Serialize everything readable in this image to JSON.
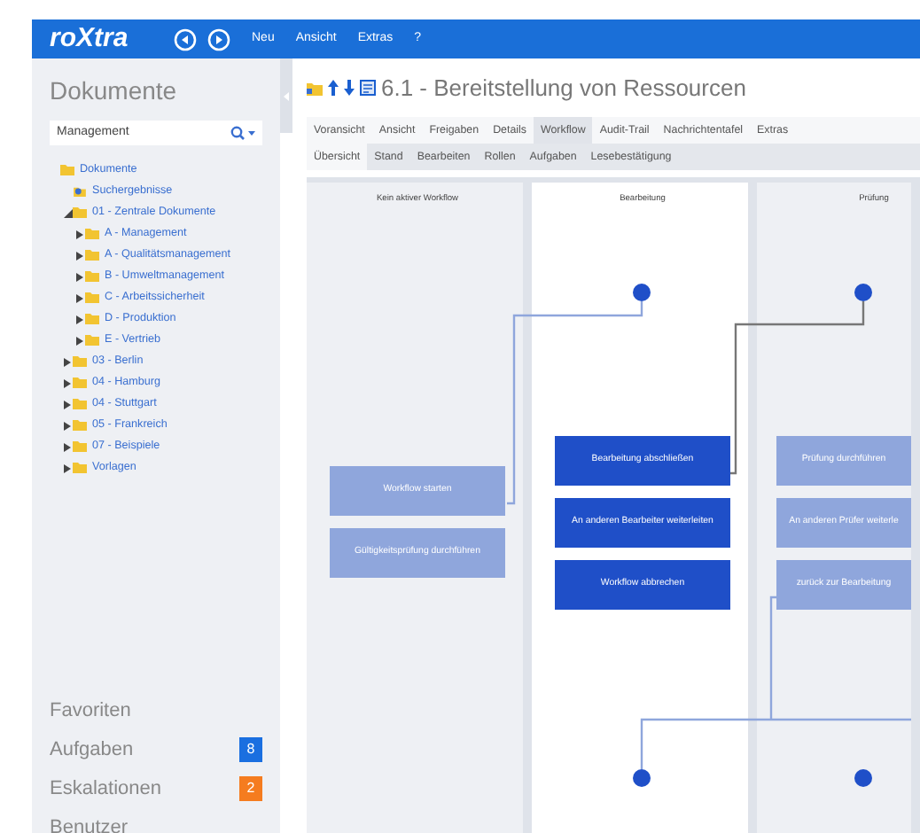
{
  "app": {
    "logo": "roXtra",
    "menu": [
      "Neu",
      "Ansicht",
      "Extras",
      "?"
    ]
  },
  "sidebar": {
    "title": "Dokumente",
    "search": {
      "value": "Management"
    },
    "tree": [
      {
        "label": "Dokumente",
        "kind": "folder",
        "children": [
          {
            "label": "Suchergebnisse",
            "kind": "search"
          },
          {
            "label": "01 - Zentrale Dokumente",
            "kind": "folder",
            "expanded": true,
            "children": [
              {
                "label": "A - Management",
                "kind": "folder",
                "expanded": false
              },
              {
                "label": "A - Qualitätsmanagement",
                "kind": "folder",
                "expanded": false
              },
              {
                "label": "B - Umweltmanagement",
                "kind": "folder",
                "expanded": false
              },
              {
                "label": "C - Arbeitssicherheit",
                "kind": "folder",
                "expanded": false
              },
              {
                "label": "D - Produktion",
                "kind": "folder",
                "expanded": false
              },
              {
                "label": "E - Vertrieb",
                "kind": "folder",
                "expanded": false
              }
            ]
          },
          {
            "label": "03 - Berlin",
            "kind": "folder",
            "expanded": false
          },
          {
            "label": "04 - Hamburg",
            "kind": "folder",
            "expanded": false
          },
          {
            "label": "04 - Stuttgart",
            "kind": "folder",
            "expanded": false
          },
          {
            "label": "05 - Frankreich",
            "kind": "folder",
            "expanded": false
          },
          {
            "label": "07 - Beispiele",
            "kind": "folder",
            "expanded": false
          },
          {
            "label": "Vorlagen",
            "kind": "folder",
            "expanded": false
          }
        ]
      }
    ],
    "links": [
      {
        "label": "Favoriten"
      },
      {
        "label": "Aufgaben",
        "badge": "8",
        "color": "#1a6fe0"
      },
      {
        "label": "Eskalationen",
        "badge": "2",
        "color": "#f57c1f"
      },
      {
        "label": "Benutzer"
      }
    ]
  },
  "document": {
    "title": "6.1 - Bereitstellung von Ressourcen",
    "tabs": [
      {
        "label": "Voransicht",
        "selected": false
      },
      {
        "label": "Ansicht",
        "selected": false
      },
      {
        "label": "Freigaben",
        "selected": false
      },
      {
        "label": "Details",
        "selected": false
      },
      {
        "label": "Workflow",
        "selected": true
      },
      {
        "label": "Audit-Trail",
        "selected": false
      },
      {
        "label": "Nachrichtentafel",
        "selected": false
      },
      {
        "label": "Extras",
        "selected": false
      }
    ],
    "subtabs": [
      {
        "label": "Übersicht",
        "selected": true
      },
      {
        "label": "Stand",
        "selected": false
      },
      {
        "label": "Bearbeiten",
        "selected": false
      },
      {
        "label": "Rollen",
        "selected": false
      },
      {
        "label": "Aufgaben",
        "selected": false
      },
      {
        "label": "Lesebestätigung",
        "selected": false
      }
    ]
  },
  "workflow": {
    "columns": [
      {
        "title": "Kein aktiver Workflow",
        "current": false,
        "actions": [
          {
            "label": "Workflow starten",
            "kind": "secondary"
          },
          {
            "label": "Gültigkeitsprüfung durchführen",
            "kind": "secondary"
          }
        ]
      },
      {
        "title": "Bearbeitung",
        "current": true,
        "actions": [
          {
            "label": "Bearbeitung abschließen",
            "kind": "primary"
          },
          {
            "label": "An anderen Bearbeiter weiterleiten",
            "kind": "primary"
          },
          {
            "label": "Workflow abbrechen",
            "kind": "primary"
          }
        ]
      },
      {
        "title": "Prüfung",
        "current": false,
        "actions": [
          {
            "label": "Prüfung durchführen",
            "kind": "secondary"
          },
          {
            "label": "An anderen Prüfer weiterle",
            "kind": "secondary"
          },
          {
            "label": "zurück zur Bearbeitung",
            "kind": "secondary"
          }
        ]
      }
    ]
  }
}
